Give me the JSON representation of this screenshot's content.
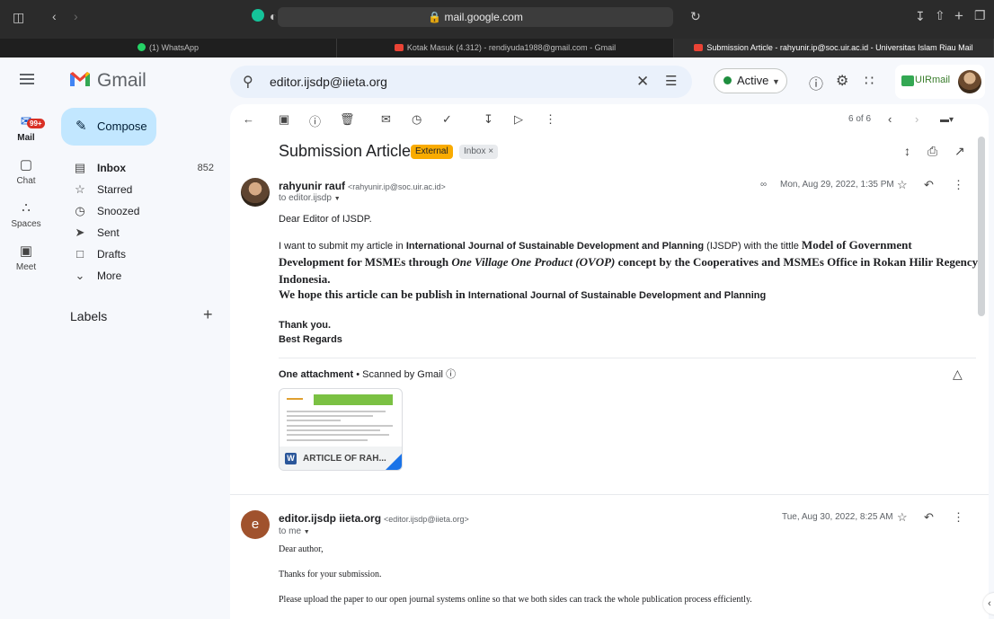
{
  "browser": {
    "url": "mail.google.com",
    "tabs": [
      {
        "label": "(1) WhatsApp",
        "icon": "whatsapp-icon",
        "color": "#25d366"
      },
      {
        "label": "Kotak Masuk (4.312) - rendiyuda1988@gmail.com - Gmail",
        "icon": "gmail-icon",
        "color": "#ea4335"
      },
      {
        "label": "Submission Article - rahyunir.ip@soc.uir.ac.id - Universitas Islam Riau Mail",
        "icon": "gmail-icon",
        "color": "#ea4335"
      }
    ]
  },
  "header": {
    "app_name": "Gmail",
    "search_value": "editor.ijsdp@iieta.org",
    "status": "Active",
    "account_label": "UIRmail"
  },
  "rail": {
    "mail_badge": "99+",
    "items": [
      {
        "label": "Mail",
        "icon": "mail-icon"
      },
      {
        "label": "Chat",
        "icon": "chat-icon"
      },
      {
        "label": "Spaces",
        "icon": "spaces-icon"
      },
      {
        "label": "Meet",
        "icon": "meet-icon"
      }
    ]
  },
  "nav": {
    "compose_label": "Compose",
    "items": [
      {
        "label": "Inbox",
        "count": "852",
        "icon": "inbox-icon"
      },
      {
        "label": "Starred",
        "count": "",
        "icon": "star-icon"
      },
      {
        "label": "Snoozed",
        "count": "",
        "icon": "clock-icon"
      },
      {
        "label": "Sent",
        "count": "",
        "icon": "send-icon"
      },
      {
        "label": "Drafts",
        "count": "",
        "icon": "draft-icon"
      },
      {
        "label": "More",
        "count": "",
        "icon": "chevron-down-icon"
      }
    ],
    "labels_heading": "Labels"
  },
  "thread": {
    "pager": "6 of 6",
    "subject": "Submission Article",
    "chip_external": "External",
    "chip_inbox": "Inbox ×"
  },
  "message1": {
    "sender_name": "rahyunir rauf",
    "sender_email": "<rahyunir.ip@soc.uir.ac.id>",
    "to": "to editor.ijsdp",
    "date": "Mon, Aug 29, 2022, 1:35 PM",
    "greeting": "Dear Editor of IJSDP.",
    "p1_a": "I want to submit my article in ",
    "p1_journal": "International Journal of Sustainable Development and Planning",
    "p1_b": " (IJSDP) with the tittle ",
    "p1_title_a": "Model of Government Development for MSMEs through ",
    "p1_title_italic": "One Village One Product (OVOP)",
    "p1_title_b": " concept by the Cooperatives and MSMEs Office in Rokan Hilir Regency Indonesia.",
    "p2_a": "We hope this article can be publish in ",
    "p2_journal": "International Journal of Sustainable Development and Planning",
    "thanks": "Thank you.",
    "regards": "Best Regards",
    "attachment_heading": "One attachment",
    "attachment_scanned": "Scanned by Gmail",
    "attachment_name": "ARTICLE OF RAH..."
  },
  "message2": {
    "sender_name": "editor.ijsdp iieta.org",
    "sender_email": "<editor.ijsdp@iieta.org>",
    "to": "to me",
    "avatar_letter": "e",
    "date": "Tue, Aug 30, 2022, 8:25 AM",
    "l1": "Dear author,",
    "l2": "Thanks for your submission.",
    "l3": "Please upload the paper to our open journal systems online so that we both sides can track the whole publication process efficiently."
  }
}
